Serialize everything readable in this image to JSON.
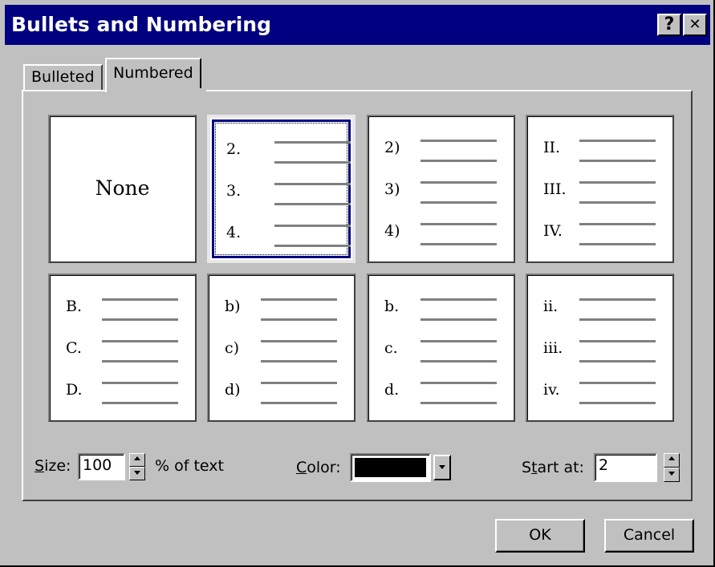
{
  "title": "Bullets and Numbering",
  "title_buttons": {
    "help": "?",
    "close": "✕"
  },
  "tabs": [
    {
      "label": "Bulleted",
      "active": false
    },
    {
      "label": "Numbered",
      "active": true
    }
  ],
  "styles": [
    {
      "label": "None"
    },
    {
      "items": [
        "2.",
        "3.",
        "4."
      ],
      "selected": true
    },
    {
      "items": [
        "2)",
        "3)",
        "4)"
      ]
    },
    {
      "items": [
        "II.",
        "III.",
        "IV."
      ]
    },
    {
      "items": [
        "B.",
        "C.",
        "D."
      ]
    },
    {
      "items": [
        "b)",
        "c)",
        "d)"
      ]
    },
    {
      "items": [
        "b.",
        "c.",
        "d."
      ]
    },
    {
      "items": [
        "ii.",
        "iii.",
        "iv."
      ]
    }
  ],
  "size": {
    "label_mnemonic": "S",
    "label_rest": "ize:",
    "value": "100",
    "suffix": "% of text"
  },
  "color": {
    "label_mnemonic": "C",
    "label_rest": "olor:",
    "swatch": "#000000"
  },
  "start_at": {
    "label_pre": "S",
    "label_mnemonic": "t",
    "label_rest": "art at:",
    "value": "2"
  },
  "buttons": {
    "ok": "OK",
    "cancel": "Cancel"
  },
  "colors": {
    "titlebar": "#000080",
    "face": "#c0c0c0",
    "selection": "#000080"
  }
}
